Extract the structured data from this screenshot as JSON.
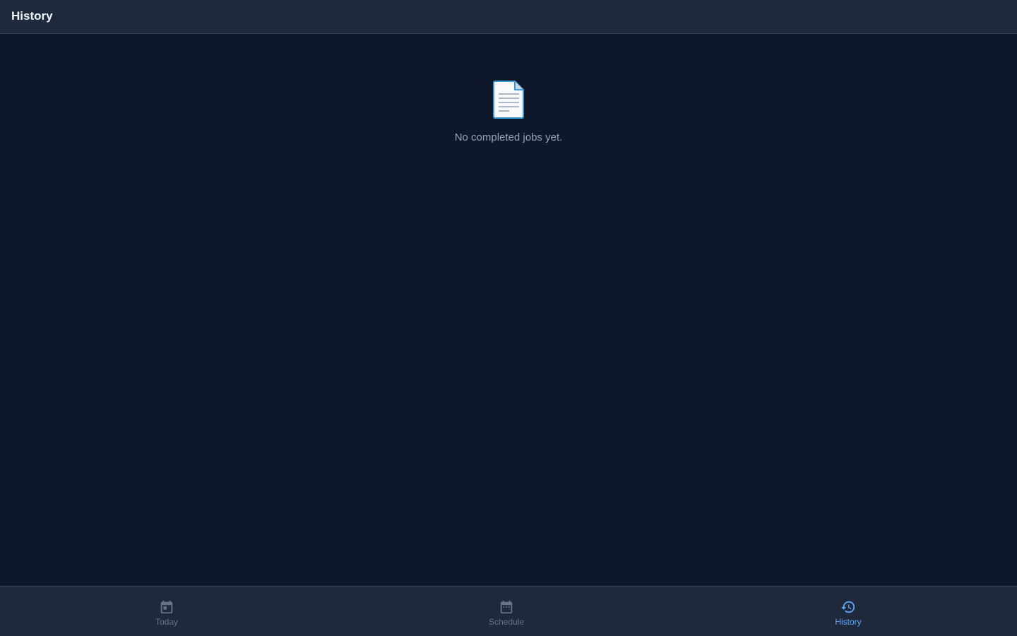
{
  "header": {
    "title": "History"
  },
  "main": {
    "empty_state": {
      "icon": "document-icon",
      "message": "No completed jobs yet."
    }
  },
  "bottom_nav": {
    "items": [
      {
        "label": "Today",
        "icon": "calendar-today-icon",
        "active": false
      },
      {
        "label": "Schedule",
        "icon": "calendar-schedule-icon",
        "active": false
      },
      {
        "label": "History",
        "icon": "history-icon",
        "active": true
      }
    ]
  },
  "colors": {
    "background": "#0f172a",
    "surface": "#1e293b",
    "accent": "#60a5fa",
    "muted": "#64748b",
    "text_secondary": "#94a3b8"
  }
}
